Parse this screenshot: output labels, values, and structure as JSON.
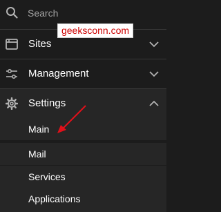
{
  "search": {
    "placeholder": "Search",
    "value": ""
  },
  "nav": {
    "items": [
      {
        "label": "Sites",
        "icon": "browser-window-icon",
        "expanded": false
      },
      {
        "label": "Management",
        "icon": "sliders-icon",
        "expanded": false
      },
      {
        "label": "Settings",
        "icon": "gear-icon",
        "expanded": true
      }
    ],
    "settings_subitems": [
      {
        "label": "Main"
      },
      {
        "label": "Mail"
      },
      {
        "label": "Services"
      },
      {
        "label": "Applications"
      }
    ]
  },
  "watermark": {
    "text": "geeksconn.com"
  },
  "colors": {
    "background": "#1c1c1c",
    "active_background": "#262626",
    "text": "#ffffff",
    "icon": "#b3b3b3",
    "annotation_arrow": "#e0101a",
    "watermark_text": "#cc0000"
  }
}
